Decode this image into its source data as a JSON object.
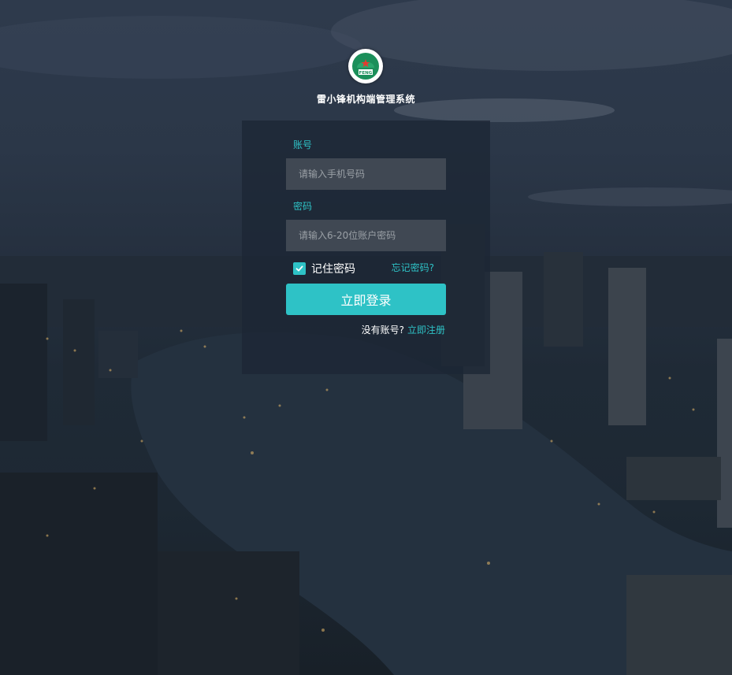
{
  "brand": {
    "title": "雷小锋机构端管理系统",
    "logo_icon": "lei-feng-logo-icon",
    "logo_text": "FENG"
  },
  "form": {
    "account_label": "账号",
    "account_placeholder": "请输入手机号码",
    "password_label": "密码",
    "password_placeholder": "请输入6-20位账户密码",
    "remember_label": "记住密码",
    "remember_checked": true,
    "forgot_link": "忘记密码?",
    "login_button": "立即登录",
    "no_account_text": "没有账号?",
    "register_link": "立即注册"
  },
  "colors": {
    "accent": "#2ec2c6",
    "panel": "#1c2634",
    "input_bg": "#464e58"
  }
}
